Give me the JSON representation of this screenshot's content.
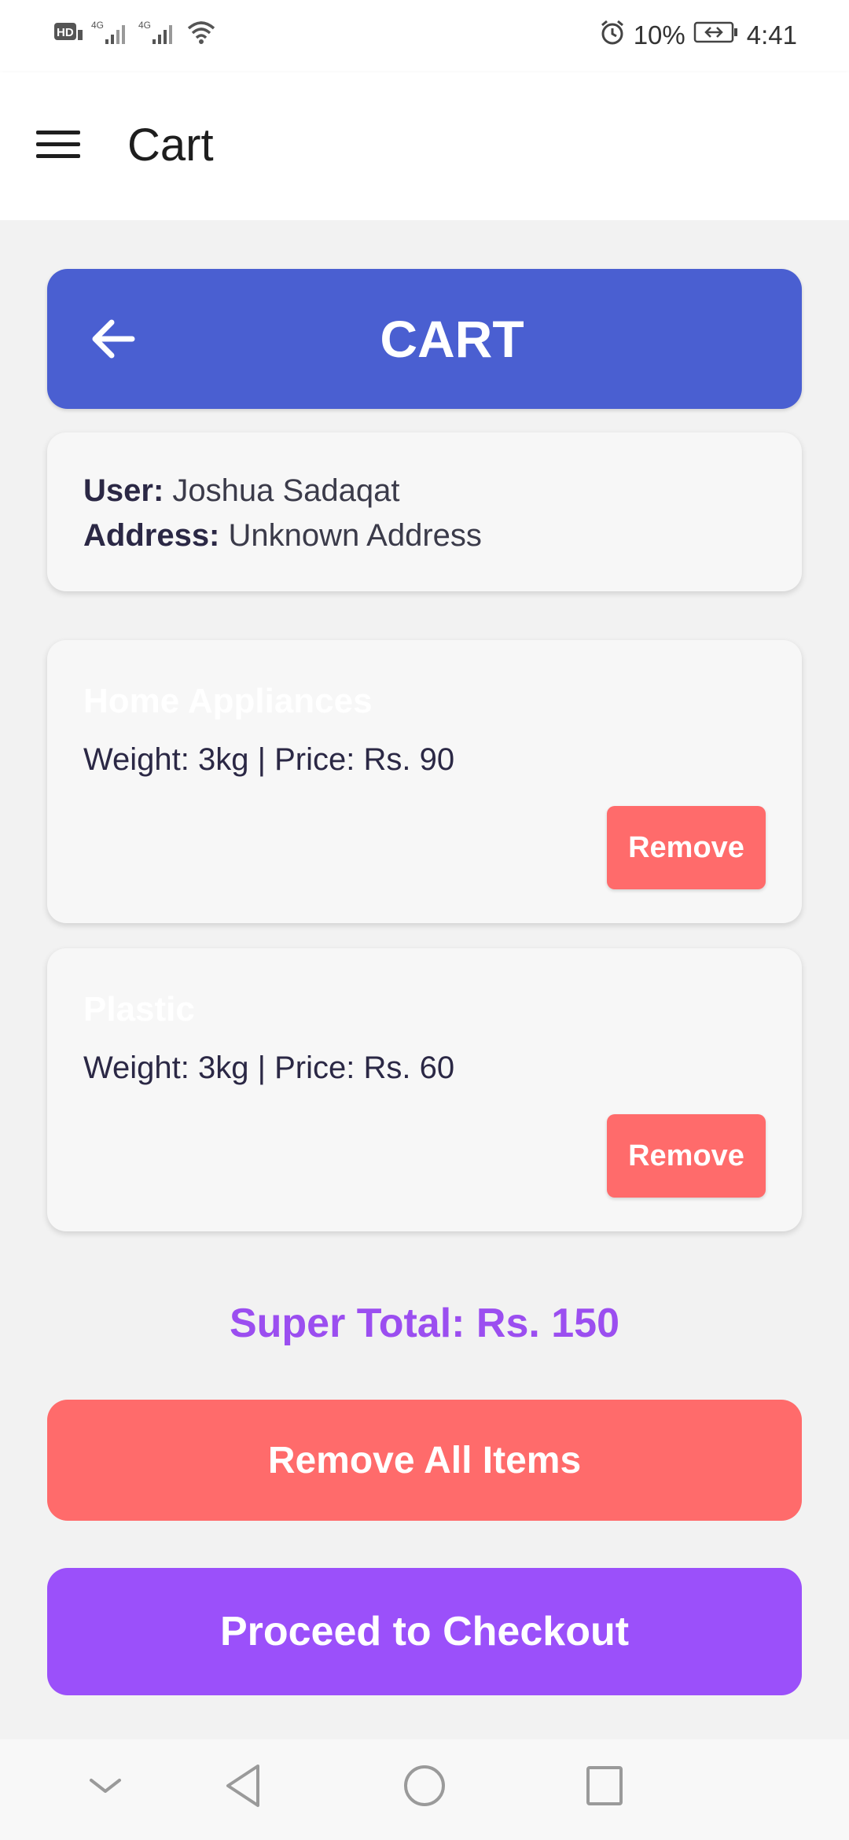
{
  "status_bar": {
    "network_badge": "HD",
    "signal_1": "4G",
    "signal_2": "4G",
    "battery_percent": "10%",
    "time": "4:41",
    "icons": [
      "hd-icon",
      "signal-icon",
      "signal-icon",
      "wifi-icon",
      "alarm-icon",
      "battery-charging-icon"
    ]
  },
  "app_bar": {
    "menu_icon": "hamburger-menu-icon",
    "title": "Cart"
  },
  "cart_header": {
    "back_icon": "arrow-left-icon",
    "title": "CART"
  },
  "user_info": {
    "user_label": "User:",
    "user_value": "Joshua Sadaqat",
    "address_label": "Address:",
    "address_value": "Unknown Address"
  },
  "items": [
    {
      "name": "Home Appliances",
      "detail": "Weight: 3kg | Price: Rs. 90",
      "remove_label": "Remove"
    },
    {
      "name": "Plastic",
      "detail": "Weight: 3kg | Price: Rs. 60",
      "remove_label": "Remove"
    }
  ],
  "summary": {
    "super_total": "Super Total: Rs. 150"
  },
  "actions": {
    "remove_all_label": "Remove All Items",
    "checkout_label": "Proceed to Checkout"
  },
  "nav_bar": {
    "icons": [
      "chevron-down-icon",
      "back-triangle-icon",
      "home-circle-icon",
      "recents-square-icon"
    ]
  },
  "colors": {
    "header_blue": "#4a5fd1",
    "remove_red": "#ff6b6b",
    "accent_purple": "#9b50fa",
    "total_purple": "#9b4ef0"
  }
}
